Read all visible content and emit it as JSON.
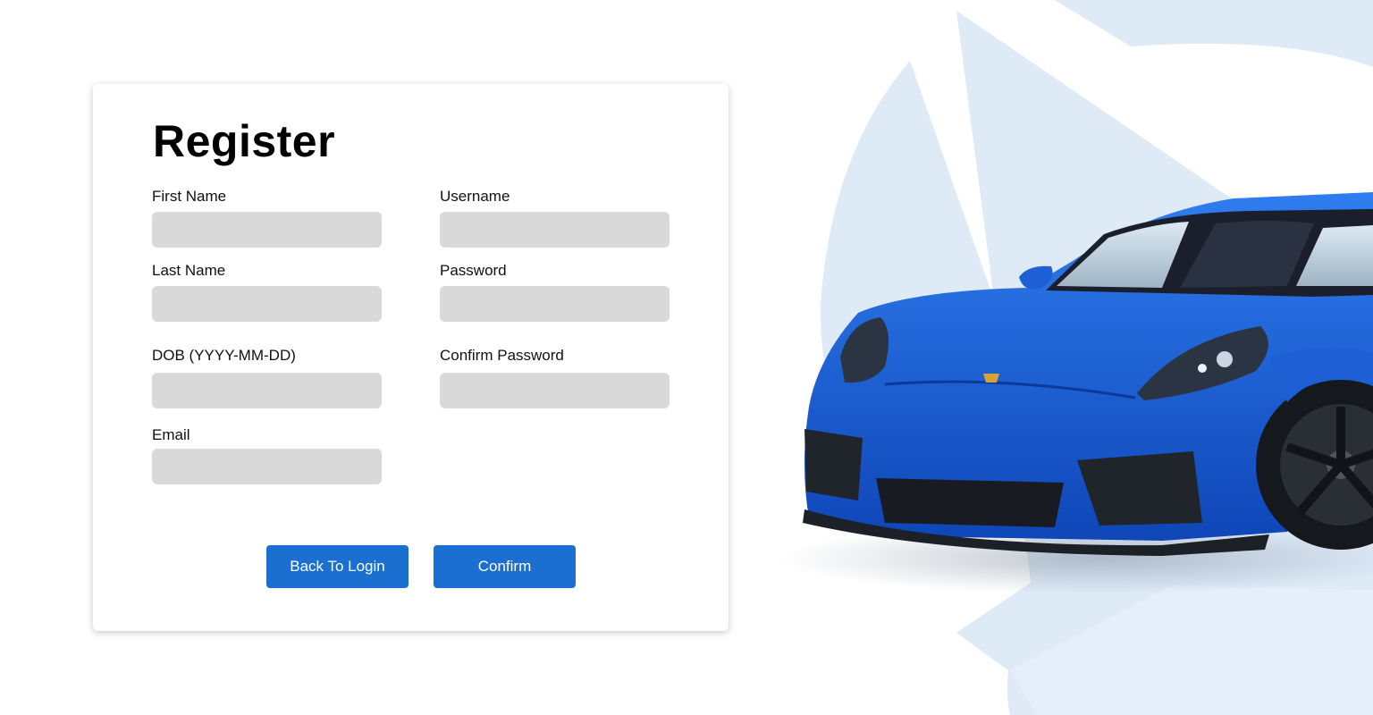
{
  "form": {
    "title": "Register",
    "fields": {
      "first_name": {
        "label": "First Name",
        "value": "",
        "placeholder": ""
      },
      "last_name": {
        "label": "Last Name",
        "value": "",
        "placeholder": ""
      },
      "dob": {
        "label": "DOB (YYYY-MM-DD)",
        "value": "",
        "placeholder": ""
      },
      "email": {
        "label": "Email",
        "value": "",
        "placeholder": ""
      },
      "username": {
        "label": "Username",
        "value": "",
        "placeholder": ""
      },
      "password": {
        "label": "Password",
        "value": "",
        "placeholder": ""
      },
      "confirm_password": {
        "label": "Confirm Password",
        "value": "",
        "placeholder": ""
      }
    },
    "buttons": {
      "back_to_login": "Back To Login",
      "confirm": "Confirm"
    }
  },
  "colors": {
    "accent": "#1b6fd1",
    "input_background": "#d9d9d9",
    "decor_shape": "#dfeaf7",
    "car_body": "#1f5fd6"
  },
  "images": {
    "hero": "blue-sports-car-image"
  }
}
